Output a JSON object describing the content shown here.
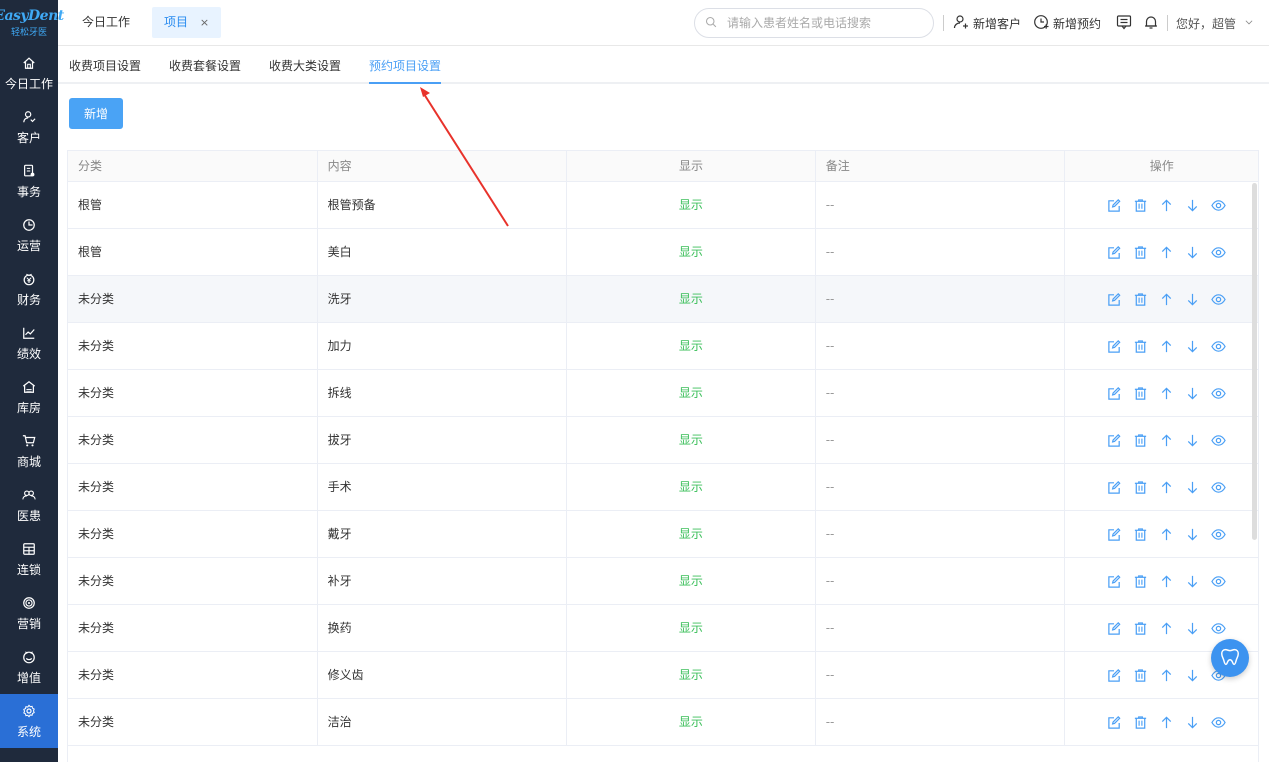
{
  "logo": {
    "main": "EasyDent",
    "sub": "轻松牙医"
  },
  "sidebar": {
    "items": [
      {
        "label": "今日工作",
        "icon": "home-icon"
      },
      {
        "label": "客户",
        "icon": "user-icon"
      },
      {
        "label": "事务",
        "icon": "document-icon"
      },
      {
        "label": "运营",
        "icon": "clock-icon"
      },
      {
        "label": "财务",
        "icon": "wallet-icon"
      },
      {
        "label": "绩效",
        "icon": "line-chart-icon"
      },
      {
        "label": "库房",
        "icon": "warehouse-icon"
      },
      {
        "label": "商城",
        "icon": "cart-icon"
      },
      {
        "label": "医患",
        "icon": "people-icon"
      },
      {
        "label": "连锁",
        "icon": "store-icon"
      },
      {
        "label": "营销",
        "icon": "target-icon"
      },
      {
        "label": "增值",
        "icon": "smile-icon"
      },
      {
        "label": "系统",
        "icon": "settings-icon",
        "active": true
      }
    ]
  },
  "header": {
    "tabs": [
      {
        "label": "今日工作"
      },
      {
        "label": "项目",
        "close": "×"
      }
    ],
    "search_placeholder": "请输入患者姓名或电话搜索",
    "new_customer": "新增客户",
    "new_appointment": "新增预约",
    "greeting": "您好，超管",
    "colors": {
      "accent": "#2a8cf0",
      "sidebar_bg": "#1f2a3c",
      "active_nav": "#2a6fd6"
    }
  },
  "subtabs": [
    {
      "label": "收费项目设置"
    },
    {
      "label": "收费套餐设置"
    },
    {
      "label": "收费大类设置"
    },
    {
      "label": "预约项目设置",
      "active": true
    }
  ],
  "add_button": "新增",
  "table": {
    "headers": [
      "分类",
      "内容",
      "显示",
      "备注",
      "操作"
    ],
    "rows": [
      {
        "category": "根管",
        "content": "根管预备",
        "display": "显示",
        "note": "--"
      },
      {
        "category": "根管",
        "content": "美白",
        "display": "显示",
        "note": "--"
      },
      {
        "category": "未分类",
        "content": "洗牙",
        "display": "显示",
        "note": "--"
      },
      {
        "category": "未分类",
        "content": "加力",
        "display": "显示",
        "note": "--"
      },
      {
        "category": "未分类",
        "content": "拆线",
        "display": "显示",
        "note": "--"
      },
      {
        "category": "未分类",
        "content": "拔牙",
        "display": "显示",
        "note": "--"
      },
      {
        "category": "未分类",
        "content": "手术",
        "display": "显示",
        "note": "--"
      },
      {
        "category": "未分类",
        "content": "戴牙",
        "display": "显示",
        "note": "--"
      },
      {
        "category": "未分类",
        "content": "补牙",
        "display": "显示",
        "note": "--"
      },
      {
        "category": "未分类",
        "content": "换药",
        "display": "显示",
        "note": "--"
      },
      {
        "category": "未分类",
        "content": "修义齿",
        "display": "显示",
        "note": "--"
      },
      {
        "category": "未分类",
        "content": "洁治",
        "display": "显示",
        "note": "--"
      }
    ],
    "highlight_row": 2,
    "actions": [
      "edit-icon",
      "delete-icon",
      "move-up-icon",
      "move-down-icon",
      "view-icon"
    ]
  },
  "colors": {
    "show_text": "#3bbf5a",
    "op_icon": "#4a9ff5",
    "annotation_arrow": "#e8322b"
  }
}
